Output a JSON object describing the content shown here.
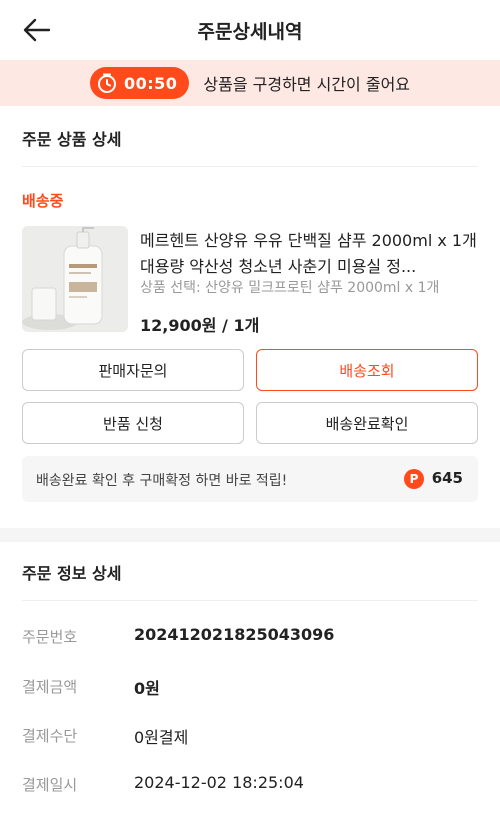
{
  "header": {
    "title": "주문상세내역",
    "back_icon": "arrow-left-icon"
  },
  "timer_banner": {
    "time": "00:50",
    "message": "상품을 구경하면 시간이 줄어요",
    "icon": "stopwatch-icon",
    "accent": "#ff4a1c",
    "background": "#fde8e3"
  },
  "order_products": {
    "title": "주문 상품 상세",
    "status": "배송중",
    "product": {
      "name": "메르헨트 산양유 우유 단백질 샴푸 2000ml x 1개 대용량 약산성 청소년 사춘기 미용실 정...",
      "option": "상품 선택: 산양유 밀크프로틴 샴푸 2000ml x 1개",
      "price": "12,900원 / 1개"
    },
    "buttons": {
      "seller_inquiry": "판매자문의",
      "track_delivery": "배송조회",
      "return_request": "반품 신청",
      "confirm_delivery": "배송완료확인"
    },
    "points": {
      "message": "배송완료 확인 후 구매확정 하면 바로 적립!",
      "badge": "P",
      "value": "645"
    }
  },
  "order_info": {
    "title": "주문 정보 상세",
    "rows": [
      {
        "label": "주문번호",
        "value": "20241202182504309​6"
      },
      {
        "label": "결제금액",
        "value": "0원"
      },
      {
        "label": "결제수단",
        "value": "0원결제"
      },
      {
        "label": "결제일시",
        "value": "2024-12-02 18:25:04"
      }
    ]
  }
}
